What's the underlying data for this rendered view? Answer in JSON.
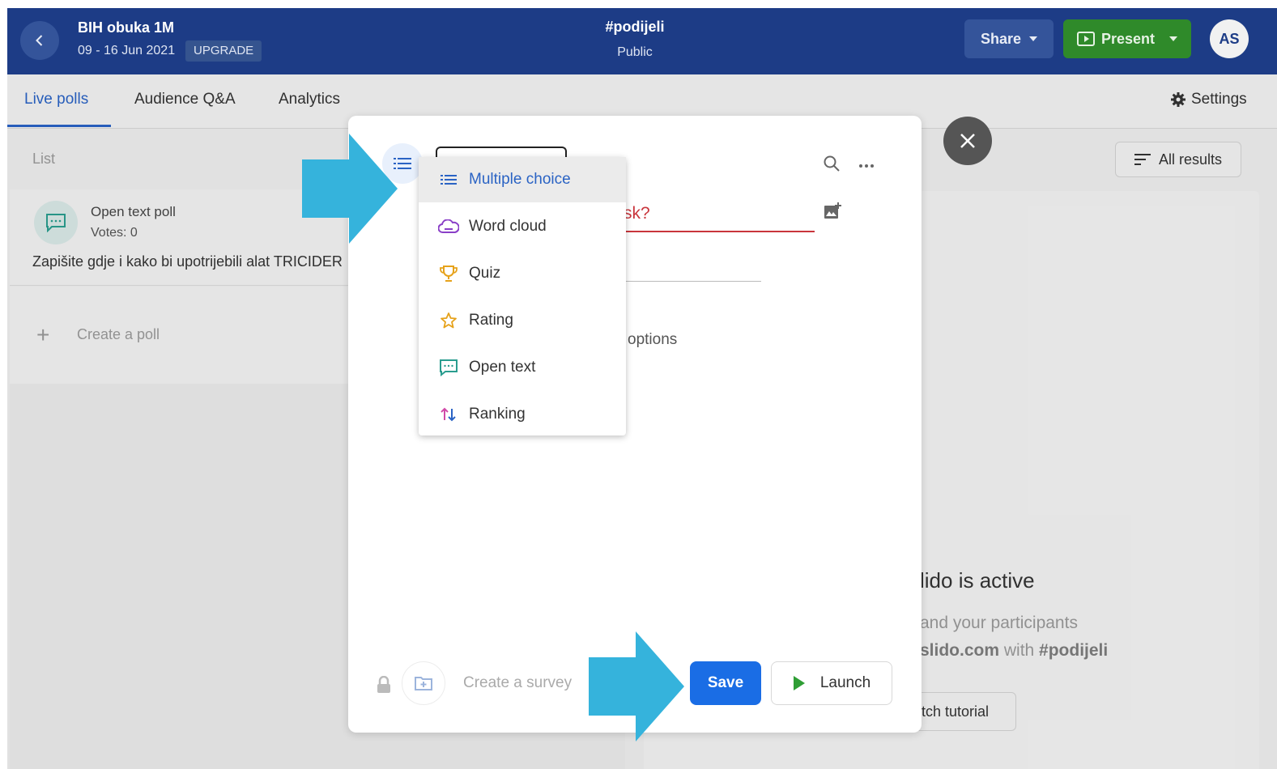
{
  "header": {
    "event_name": "BIH obuka 1M",
    "event_dates": "09 - 16 Jun 2021",
    "upgrade_label": "UPGRADE",
    "event_code": "#podijeli",
    "event_visibility": "Public",
    "share_label": "Share",
    "present_label": "Present",
    "avatar_initials": "AS"
  },
  "tabs": [
    {
      "label": "Live polls",
      "active": true
    },
    {
      "label": "Audience Q&A",
      "active": false
    },
    {
      "label": "Analytics",
      "active": false
    }
  ],
  "settings_label": "Settings",
  "list": {
    "heading": "List",
    "poll": {
      "type": "Open text poll",
      "votes": "Votes: 0",
      "text": "Zapišite gdje i kako bi upotrijebili alat TRICIDER"
    },
    "create_label": "Create a poll"
  },
  "results": {
    "all_results_label": "All results",
    "active_title": "lido is active",
    "line1": "and your participants",
    "line2_prefix": "slido.com",
    "line2_mid": " with ",
    "line2_code": "#podijeli",
    "tutorial_label": "tch tutorial"
  },
  "modal": {
    "question_partial": "sk?",
    "options_partial": "options",
    "create_survey_label": "Create a survey",
    "save_label": "Save",
    "launch_label": "Launch"
  },
  "poll_types": [
    {
      "label": "Multiple choice",
      "icon": "list-icon",
      "selected": true
    },
    {
      "label": "Word cloud",
      "icon": "cloud-icon",
      "selected": false
    },
    {
      "label": "Quiz",
      "icon": "trophy-icon",
      "selected": false
    },
    {
      "label": "Rating",
      "icon": "star-icon",
      "selected": false
    },
    {
      "label": "Open text",
      "icon": "chat-icon",
      "selected": false
    },
    {
      "label": "Ranking",
      "icon": "ranking-arrows-icon",
      "selected": false
    }
  ],
  "colors": {
    "header_bg": "#1d3c86",
    "accent": "#2a63c4",
    "present_green": "#2f8a2a",
    "save_blue": "#1a6de5",
    "error_red": "#c9353c",
    "pointer_arrow": "#35b3dc"
  }
}
